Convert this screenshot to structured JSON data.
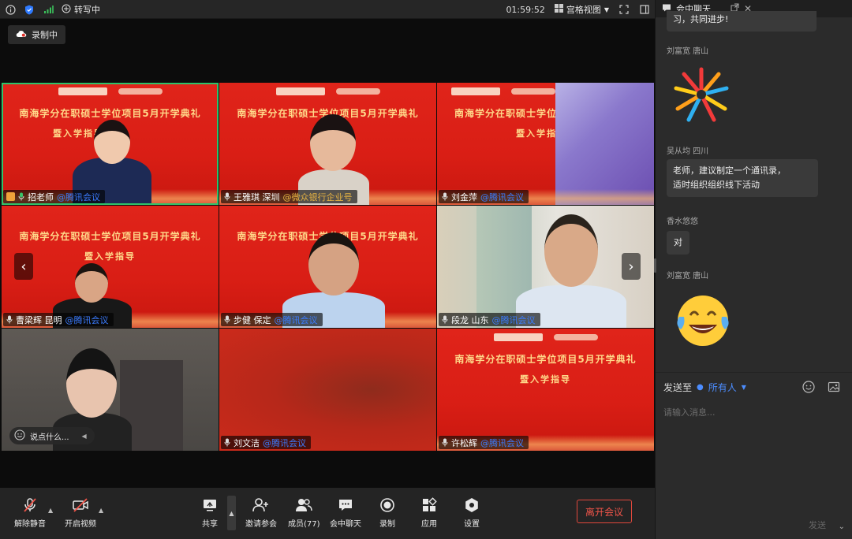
{
  "topbar": {
    "recording_title": "转写中",
    "clock": "01:59:52",
    "view_mode": "宫格视图"
  },
  "recording_badge": "录制中",
  "tiles": [
    {
      "name": "招老师",
      "app": "@腾讯会议",
      "slogan1": "南海学分在职硕士学位项目5月开学典礼",
      "slogan2": "暨入学指导"
    },
    {
      "name": "王雅琪 深圳",
      "app": "@微众银行企业号",
      "slogan1": "南海学分在职硕士学位项目5月开学典礼",
      "slogan2": ""
    },
    {
      "name": "刘金萍",
      "app": "@腾讯会议",
      "slogan1": "南海学分在职硕士学位",
      "slogan2": "暨入学指"
    },
    {
      "name": "曹梁辉 昆明",
      "app": "@腾讯会议",
      "slogan1": "南海学分在职硕士学位项目5月开学典礼",
      "slogan2": "暨入学指导"
    },
    {
      "name": "步健 保定",
      "app": "@腾讯会议",
      "slogan1": "南海学分在职硕士学位项目5月开学典礼",
      "slogan2": ""
    },
    {
      "name": "段龙 山东",
      "app": "@腾讯会议",
      "slogan1": "",
      "slogan2": ""
    },
    {
      "name": "",
      "app": "",
      "slogan1": "",
      "slogan2": ""
    },
    {
      "name": "刘文洁",
      "app": "@腾讯会议",
      "slogan1": "",
      "slogan2": ""
    },
    {
      "name": "许松辉",
      "app": "@腾讯会议",
      "slogan1": "南海学分在职硕士学位项目5月开学典礼",
      "slogan2": "暨入学指导"
    }
  ],
  "say_prompt": "说点什么...",
  "toolbar": {
    "mute": "解除静音",
    "video": "开启视频",
    "share": "共享",
    "invite": "邀请参会",
    "members": "成员(77)",
    "chat": "会中聊天",
    "record": "录制",
    "apps": "应用",
    "settings": "设置",
    "leave": "离开会议"
  },
  "chat": {
    "title": "会中聊天",
    "partial_text": "习，共同进步!",
    "messages": [
      {
        "sender": "刘富宽  唐山",
        "content": "",
        "emoji": "fireworks-icon"
      },
      {
        "sender": "吴从均    四川",
        "content_line1": "老师，建议制定一个通讯录，",
        "content_line2": "适时组织组织线下活动"
      },
      {
        "sender": "香水悠悠",
        "content": "对"
      },
      {
        "sender": "刘富宽  唐山",
        "content": "",
        "emoji": "tears-of-joy-icon"
      }
    ],
    "send_to_label": "发送至",
    "send_to_target": "所有人",
    "input_placeholder": "请输入消息...",
    "send_button": "发送"
  },
  "colors": {
    "accent_blue": "#3b7cff",
    "leave_red": "#f0554a",
    "active_green": "#2ec26a",
    "banner_red": "#d91e15",
    "banner_gold": "#ffd98a"
  }
}
